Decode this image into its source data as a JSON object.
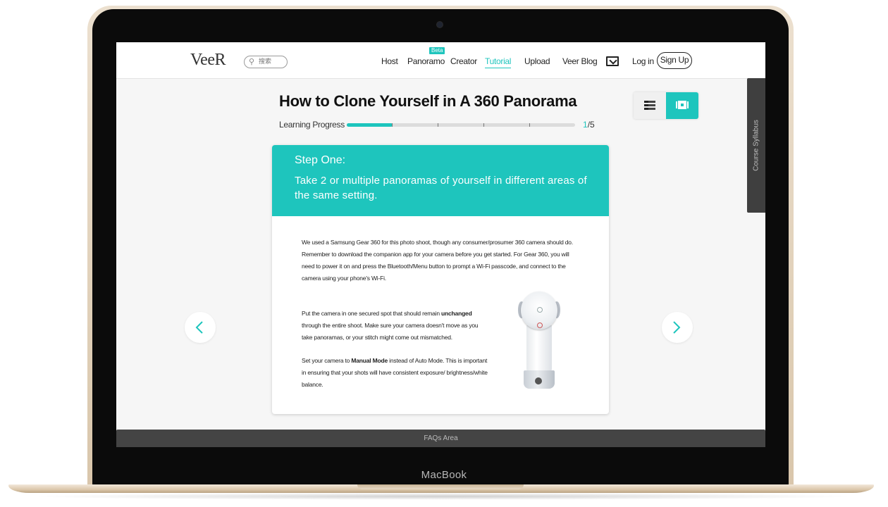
{
  "device": {
    "label": "MacBook"
  },
  "header": {
    "logo": "VeeR",
    "search_placeholder": "搜索",
    "nav": [
      {
        "label": "Host"
      },
      {
        "label": "Panoramo",
        "badge": "Beta"
      },
      {
        "label": "Creator"
      },
      {
        "label": "Tutorial",
        "active": true
      },
      {
        "label": "Upload"
      },
      {
        "label": "Veer Blog"
      }
    ],
    "mail_icon": "mail-icon",
    "login_label": "Log in",
    "signup_label": "Sign Up"
  },
  "lesson": {
    "title": "How to Clone Yourself in A 360 Panorama",
    "progress_label": "Learning Progress",
    "progress_current": "1",
    "progress_total": "/5",
    "progress_fraction": 0.2,
    "progress_steps": 5
  },
  "view_toggle": {
    "list_icon": "list-view-icon",
    "slide_icon": "slide-view-icon",
    "active": "slide"
  },
  "syllabus_tab": "Course Syllabus",
  "card": {
    "step_label": "Step One:",
    "step_title": "Take 2 or multiple panoramas of yourself in different areas of the same setting.",
    "paragraph1": "We used a Samsung Gear 360 for this photo shoot, though any consumer/prosumer 360 camera should do. Remember to download the companion app for your camera before you get started. For Gear 360, you will need to power it on and press the Bluetooth/Menu button to prompt a Wi-Fi passcode, and connect to the camera using your phone's Wi-Fi.",
    "paragraph2_before": "Put the camera in one secured spot that should remain ",
    "paragraph2_bold": "unchanged",
    "paragraph2_after": " through the entire shoot. Make sure your camera doesn't move as you take panoramas, or your stitch might come out mismatched.",
    "paragraph3_before": "Set your camera to ",
    "paragraph3_bold": "Manual Mode",
    "paragraph3_after": " instead of Auto Mode. This is important in ensuring that your shots will have consistent exposure/ brightness/white balance.",
    "image": "gear-360-camera"
  },
  "footer": {
    "faq_label": "FAQs Area"
  },
  "colors": {
    "accent": "#1ec5bd",
    "dark": "#3f3f3f"
  }
}
